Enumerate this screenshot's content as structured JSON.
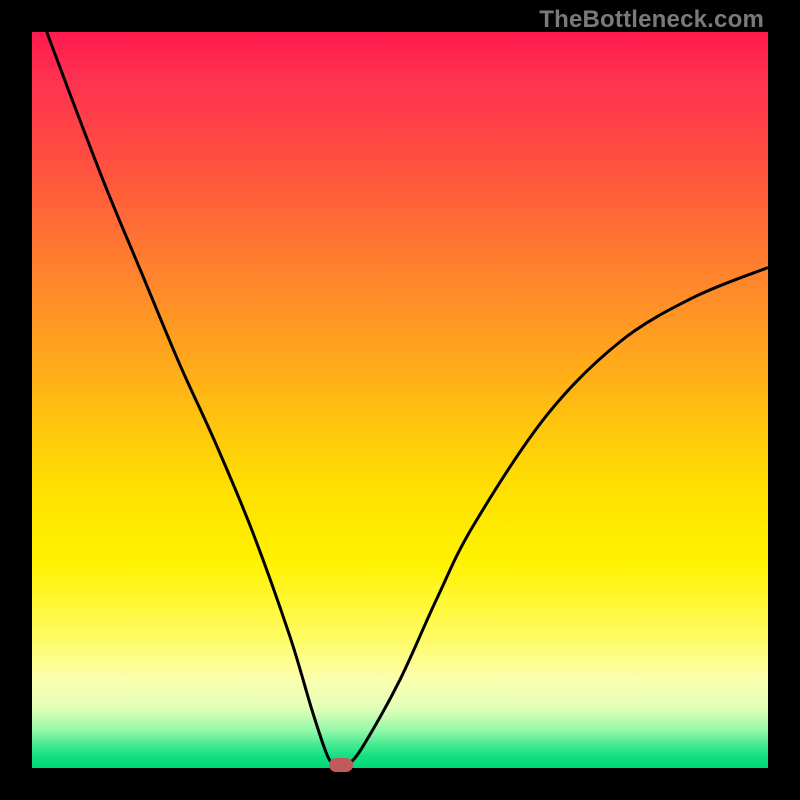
{
  "watermark": "TheBottleneck.com",
  "colors": {
    "frame": "#000000",
    "curve": "#000000",
    "marker": "#c15a5a",
    "watermark_text": "#7a7a7a"
  },
  "chart_data": {
    "type": "line",
    "title": "",
    "xlabel": "",
    "ylabel": "",
    "xlim": [
      0,
      100
    ],
    "ylim": [
      0,
      100
    ],
    "grid": false,
    "series": [
      {
        "name": "bottleneck-curve",
        "x": [
          2,
          5,
          10,
          15,
          20,
          25,
          30,
          35,
          38,
          40,
          41,
          42,
          43,
          45,
          50,
          55,
          60,
          70,
          80,
          90,
          100
        ],
        "y": [
          100,
          92,
          79,
          67,
          55,
          44,
          32,
          18,
          8,
          2,
          0.5,
          0,
          0.5,
          3,
          12,
          23,
          33,
          48,
          58,
          64,
          68
        ]
      }
    ],
    "annotations": [
      {
        "name": "optimal-marker",
        "x": 42,
        "y": 0
      }
    ],
    "background": {
      "type": "vertical-gradient",
      "stops": [
        {
          "pos": 0,
          "color": "#ff1a4d"
        },
        {
          "pos": 50,
          "color": "#ffc010"
        },
        {
          "pos": 75,
          "color": "#fff200"
        },
        {
          "pos": 100,
          "color": "#00d878"
        }
      ]
    }
  }
}
